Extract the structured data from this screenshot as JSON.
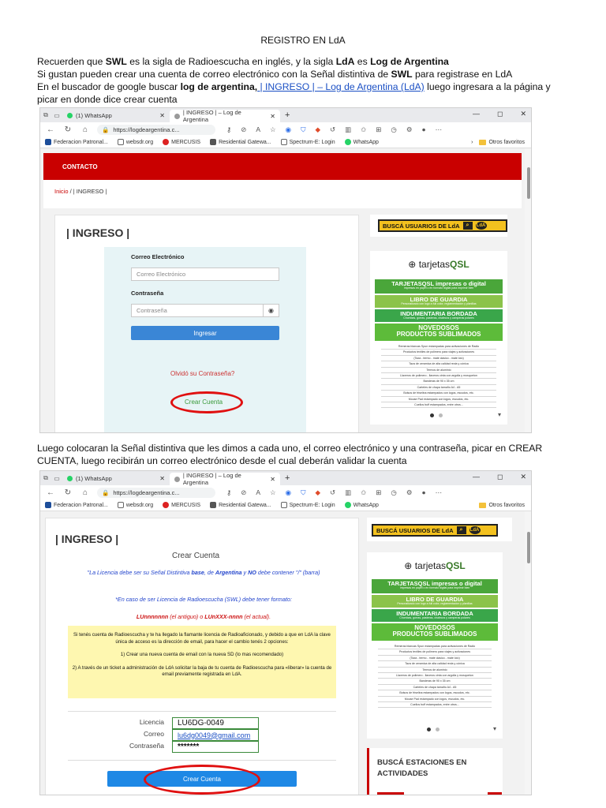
{
  "doc": {
    "title": "REGISTRO EN LdA",
    "para1": {
      "l1_a": "Recuerden que ",
      "l1_b": "SWL",
      "l1_c": " es la sigla de Radioescucha en inglés, y la sigla ",
      "l1_d": "LdA",
      "l1_e": " es ",
      "l1_f": "Log de Argentina",
      "l2_a": "Si gustan pueden crear una cuenta de correo electrónico con la Señal distintiva de ",
      "l2_b": "SWL",
      "l2_c": " para registrase en LdA",
      "l3_a": "En el buscador de google buscar ",
      "l3_b": "log de argentina,",
      "l3_link": " | INGRESO | – Log de Argentina (LdA)",
      "l3_c": " luego ingresara a la página y",
      "l4": "picar en donde dice crear cuenta"
    },
    "para2": {
      "l1": "Luego colocaran la Señal distintiva que les dimos a cada uno, el correo electrónico y una contraseña, picar en CREAR",
      "l2": "CUENTA, luego recibirán un correo electrónico desde el cual deberán validar la cuenta"
    }
  },
  "browser": {
    "tab1": "(1) WhatsApp",
    "tab2": "| INGRESO | – Log de Argentina",
    "url": "https://logdeargentina.c...",
    "favorites": [
      "Federacion Patronal...",
      "websdr.org",
      "MERCUSIS",
      "Residential Gatewa...",
      "Spectrum-E: Login",
      "WhatsApp"
    ],
    "favorites_folder": "Otros favoritos",
    "icons": [
      "back-icon",
      "reload-icon",
      "home-icon",
      "lock-icon",
      "zoom-icon",
      "star-icon",
      "settings-icon"
    ]
  },
  "site": {
    "nav_contact": "CONTACTO",
    "breadcrumb_home": "Inicio",
    "breadcrumb_rest": " / | INGRESO |",
    "heading": "| INGRESO |",
    "email_label": "Correo Electrónico",
    "email_placeholder": "Correo Electrónico",
    "password_label": "Contraseña",
    "password_placeholder": "Contraseña",
    "login_button": "Ingresar",
    "forgot": "Olvidó su Contraseña?",
    "create_link": "Crear Cuenta",
    "search_banner": "BUSCÁ USUARIOS DE LdA",
    "ad": {
      "logo_a": "tarjetas",
      "logo_b": "QSL",
      "s1": "TARJETASQSL impresas o digital",
      "s1_small": "Impresas en papel o en formato digital para imprimir bien",
      "s2": "LIBRO DE GUARDIA",
      "s2_small": "Personalizado con logo a full color, reglamentacion y planillas",
      "s3": "INDUMENTARIA BORDADA",
      "s3_small": "Chombas, gorras, pasteras, chalecos y camperas polares",
      "s4a": "NOVEDOSOS",
      "s4b": "PRODUCTOS SUBLIMADOS",
      "lines": [
        "Remeras blancas Spun estampadas para activaciones de Radio",
        "Productos textiles de polimero para viajes y activaciones",
        "(Taza - termo - mate clasico - mate lolo)",
        "Taza de ceramica de alta calidad recta y cónica",
        "Termos de aluminio",
        "Llaveros de polimero - llaveros cinta con argolla y mosqueton",
        "Banderas de 90 x 35 cm",
        "Carteles de chapa tamaño A4 - A5",
        "Bolsos de friselina estampados con logos, escudos, etc.",
        "Mouse Pad estampado con logos, escudos, etc.",
        "Cuellos buff estampados, entre otros..."
      ]
    }
  },
  "signup": {
    "heading": "| INGRESO |",
    "subheading": "Crear Cuenta",
    "note1_a": "\"La Licencia debe ser su Señal Distintiva ",
    "note1_b": "base",
    "note1_c": ", de ",
    "note1_d": "Argentina",
    "note1_e": " y ",
    "note1_f": "NO",
    "note1_g": " debe contener \"/\" (barra)",
    "note2": "*En caso de ser Licencia de Radioescucha (SWL) debe tener formato:",
    "note3_a": "LUnnnnnnn",
    "note3_b": " (el antiguo) o ",
    "note3_c": "LUnXXX-nnnn",
    "note3_d": " (el actual).",
    "yellow_p1": "Si tenés cuenta de Radioescucha y te ha llegado la flamante licencia de Radioaficionado, y debido a que en LdA la clave única de acceso es la dirección de email, para hacer el cambio tenés 2 opciones:",
    "yellow_p2": "1) Crear una nueva cuenta de email con la nueva SD (lo mas recomendado)",
    "yellow_p3": "2) A través de un ticket a administración de LdA solicitar la baja de tu cuenta de Radioescucha para «liberar» la cuenta de email previamente registrada en LdA.",
    "label_license": "Licencia",
    "value_license": "LU6DG-0049",
    "label_email": "Correo",
    "value_email": "lu6dg0049@gmail.com",
    "label_password": "Contraseña",
    "value_password": "*******",
    "create_button": "Crear Cuenta",
    "stations_title": "BUSCÁ ESTACIONES EN ACTIVIDADES"
  },
  "colors": {
    "brand_red": "#c90000",
    "button_blue": "#3a86d6",
    "highlight_red": "#e01010"
  }
}
